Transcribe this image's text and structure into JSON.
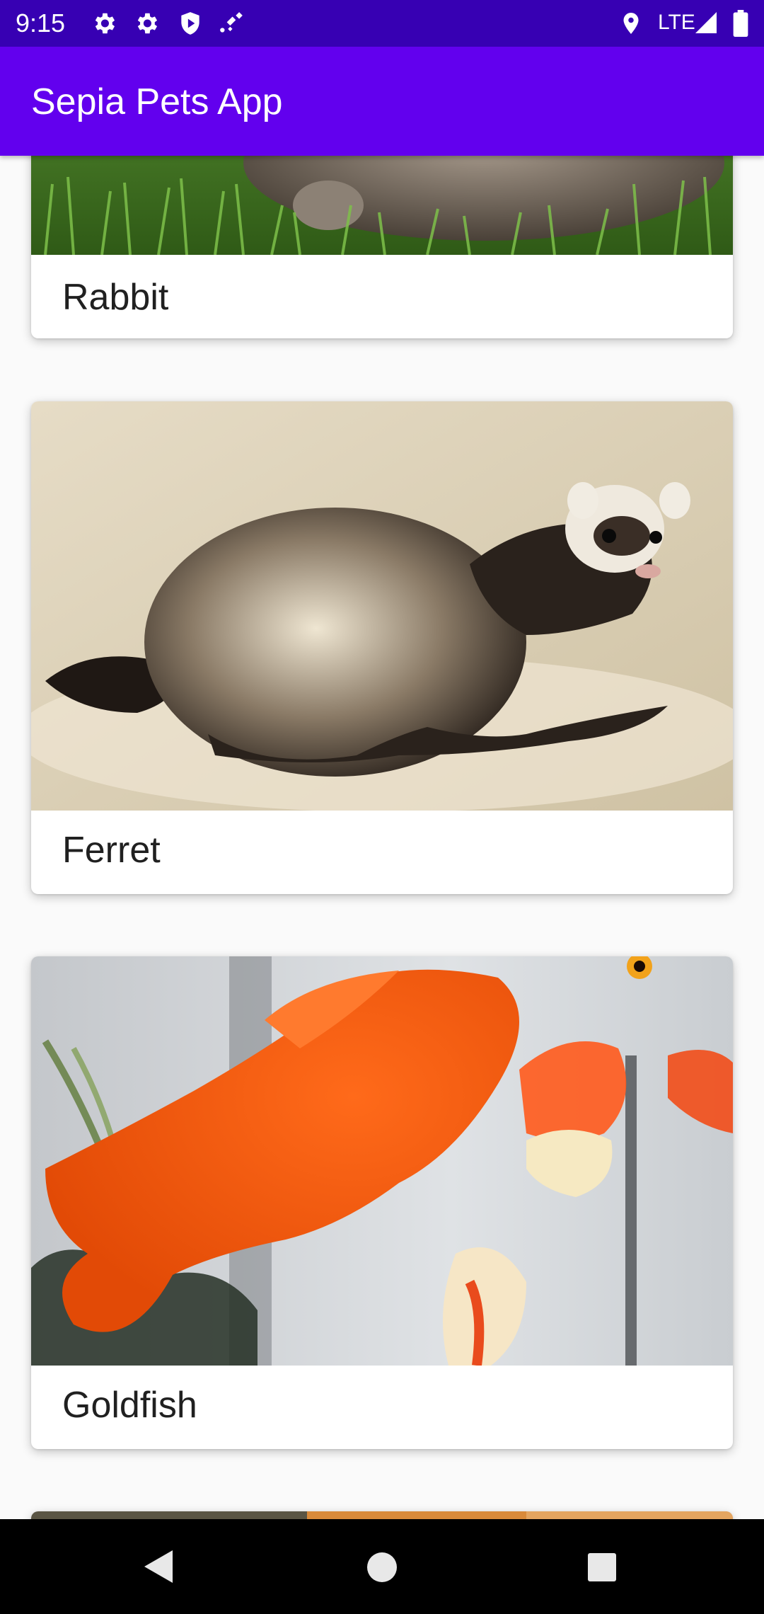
{
  "status_bar": {
    "time": "9:15",
    "network": "LTE",
    "icons": [
      "settings-icon",
      "settings-icon",
      "shield-play-icon",
      "cast-satellite-icon",
      "location-icon",
      "signal-icon",
      "battery-icon"
    ]
  },
  "app_bar": {
    "title": "Sepia Pets App"
  },
  "pets": [
    {
      "name": "Rabbit"
    },
    {
      "name": "Ferret"
    },
    {
      "name": "Goldfish"
    }
  ],
  "nav_bar": {
    "buttons": [
      "back-icon",
      "home-icon",
      "recents-icon"
    ]
  },
  "colors": {
    "status_bar": "#3700b3",
    "app_bar": "#6200ee",
    "background": "#fafafa",
    "card": "#ffffff"
  }
}
